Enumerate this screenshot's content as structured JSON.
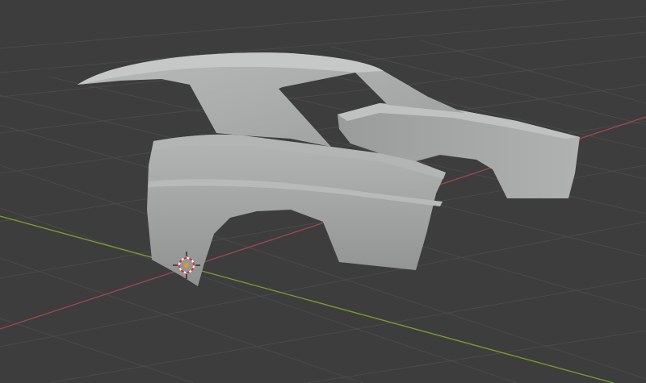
{
  "viewport": {
    "view": "3D Viewport",
    "background_color": "#3d3d3d",
    "grid_color": "#4a4a4a",
    "x_axis_color": "#9a4550",
    "y_axis_color": "#7a9a32",
    "cursor_name": "3d-cursor"
  },
  "model": {
    "name": "car-body-shell",
    "base_color": "#a9abab",
    "highlight_color": "#c2c4c4",
    "shadow_color": "#8e9090"
  }
}
